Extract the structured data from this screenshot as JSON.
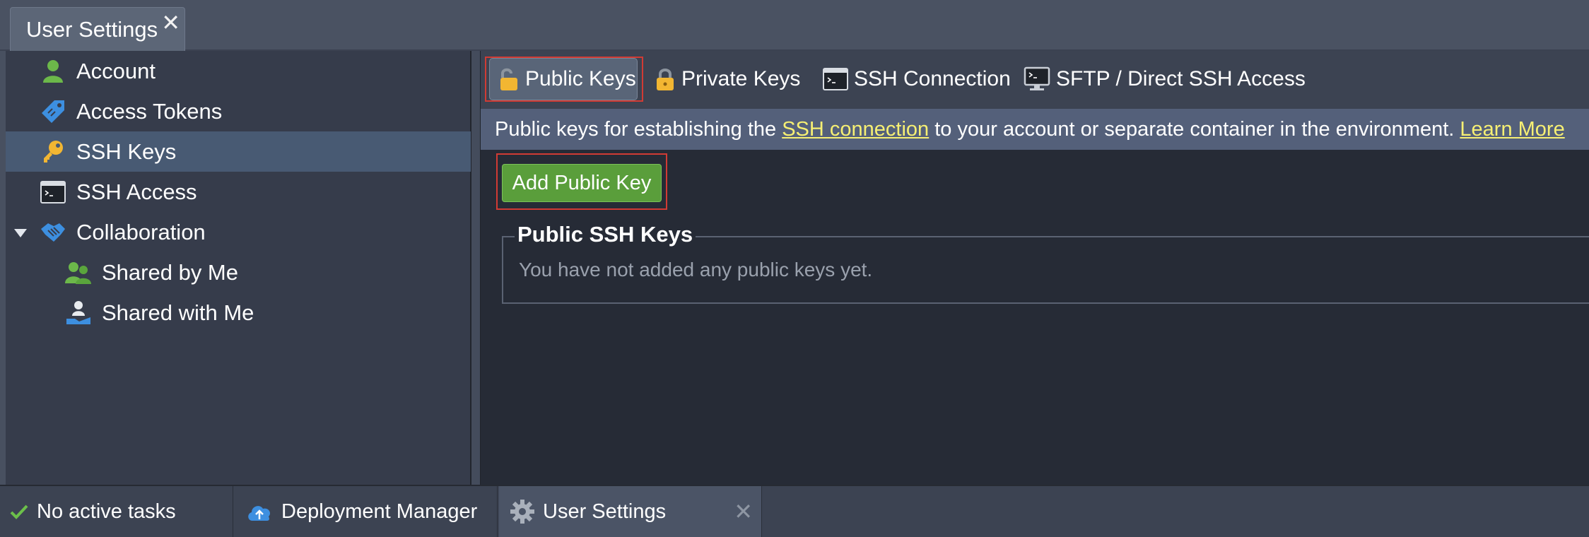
{
  "window": {
    "tab_title": "User Settings",
    "close_glyph": "✕"
  },
  "sidebar": {
    "items": [
      {
        "label": "Account",
        "icon": "user-icon"
      },
      {
        "label": "Access Tokens",
        "icon": "tag-icon"
      },
      {
        "label": "SSH Keys",
        "icon": "key-icon",
        "selected": true
      },
      {
        "label": "SSH Access",
        "icon": "terminal-icon"
      },
      {
        "label": "Collaboration",
        "icon": "handshake-icon",
        "expanded": true
      },
      {
        "label": "Shared by Me",
        "icon": "users-icon"
      },
      {
        "label": "Shared with Me",
        "icon": "hand-user-icon"
      }
    ]
  },
  "subtabs": [
    {
      "label": "Public Keys",
      "icon": "unlocked-icon",
      "active": true
    },
    {
      "label": "Private Keys",
      "icon": "lock-icon"
    },
    {
      "label": "SSH Connection",
      "icon": "terminal-icon"
    },
    {
      "label": "SFTP / Direct SSH Access",
      "icon": "monitor-icon"
    }
  ],
  "info": {
    "prefix": "Public keys for establishing the ",
    "link": "SSH connection",
    "suffix": " to your account or separate container in the environment. ",
    "learn_more": "Learn More"
  },
  "actions": {
    "add_public_key": "Add Public Key"
  },
  "public_keys_section": {
    "legend": "Public SSH Keys",
    "empty_message": "You have not added any public keys yet."
  },
  "taskbar": {
    "tasks_status": "No active tasks",
    "deployment_manager": "Deployment Manager",
    "user_settings": "User Settings",
    "close_glyph": "✕"
  },
  "colors": {
    "accent_green": "#5a9e3b",
    "link_yellow": "#f6ef73",
    "selected_row": "#485a73",
    "highlight_red": "#d13b34"
  }
}
